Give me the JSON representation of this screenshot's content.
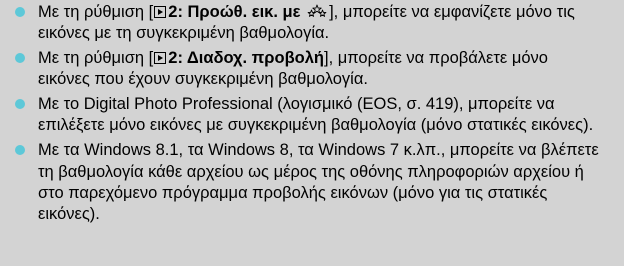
{
  "heading_fragment": "…",
  "items": [
    {
      "prefix": "Με τη ρύθμιση [",
      "menu": "2: Προώθ. εικ. με",
      "suffix": "], μπορείτε να εμφανίζετε μόνο τις εικόνες με τη συγκεκριμένη βαθμολογία."
    },
    {
      "prefix": "Με τη ρύθμιση [",
      "menu": "2: Διαδοχ. προβολή",
      "suffix": "], μπορείτε να προβάλετε μόνο εικόνες που έχουν συγκεκριμένη βαθμολογία."
    },
    {
      "text": "Με το Digital Photo Professional (λογισμικό (EOS, σ. 419), μπορείτε να επιλέξετε μόνο εικόνες με συγκεκριμένη βαθμολογία (μόνο στατικές εικόνες)."
    },
    {
      "text": "Με τα Windows 8.1, τα Windows 8, τα Windows 7 κ.λπ., μπορείτε να βλέπετε τη βαθμολογία κάθε αρχείου ως μέρος της οθόνης πληροφοριών αρχείου ή στο παρεχόμενο πρόγραμμα προβολής εικόνων (μόνο για τις στατικές εικόνες)."
    }
  ],
  "icons": {
    "bullet": "cyan-dot",
    "playback_menu": "playback-icon",
    "jump_method": "rating-stars-icon"
  },
  "colors": {
    "background": "#d3d3d3",
    "bullet": "#5dc8d8",
    "text": "#000000"
  }
}
